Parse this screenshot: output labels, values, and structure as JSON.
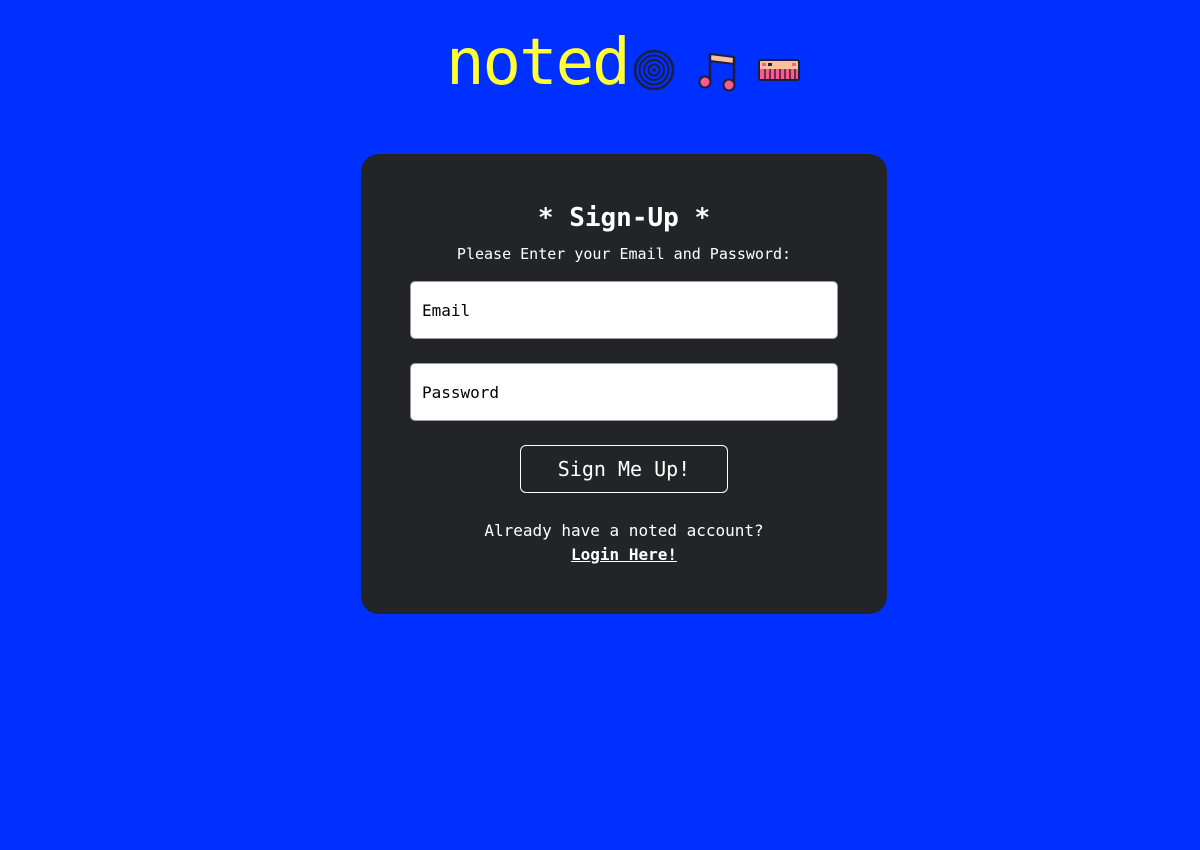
{
  "brand": {
    "name": "noted",
    "icons": [
      "vinyl-record-icon",
      "music-notes-icon",
      "keyboard-icon"
    ]
  },
  "colors": {
    "background": "#0030ff",
    "brand": "#ffff33",
    "card": "#222428",
    "icon_pink": "#ff5a8a",
    "icon_peach": "#ffc0a0",
    "icon_dark": "#1b1f3b"
  },
  "signup": {
    "title": "* Sign-Up *",
    "subtitle": "Please Enter your Email and Password:",
    "email_placeholder": "Email",
    "email_value": "",
    "password_placeholder": "Password",
    "password_value": "",
    "submit_label": "Sign Me Up!",
    "login_prompt": "Already have a noted account?",
    "login_link": "Login Here!"
  }
}
